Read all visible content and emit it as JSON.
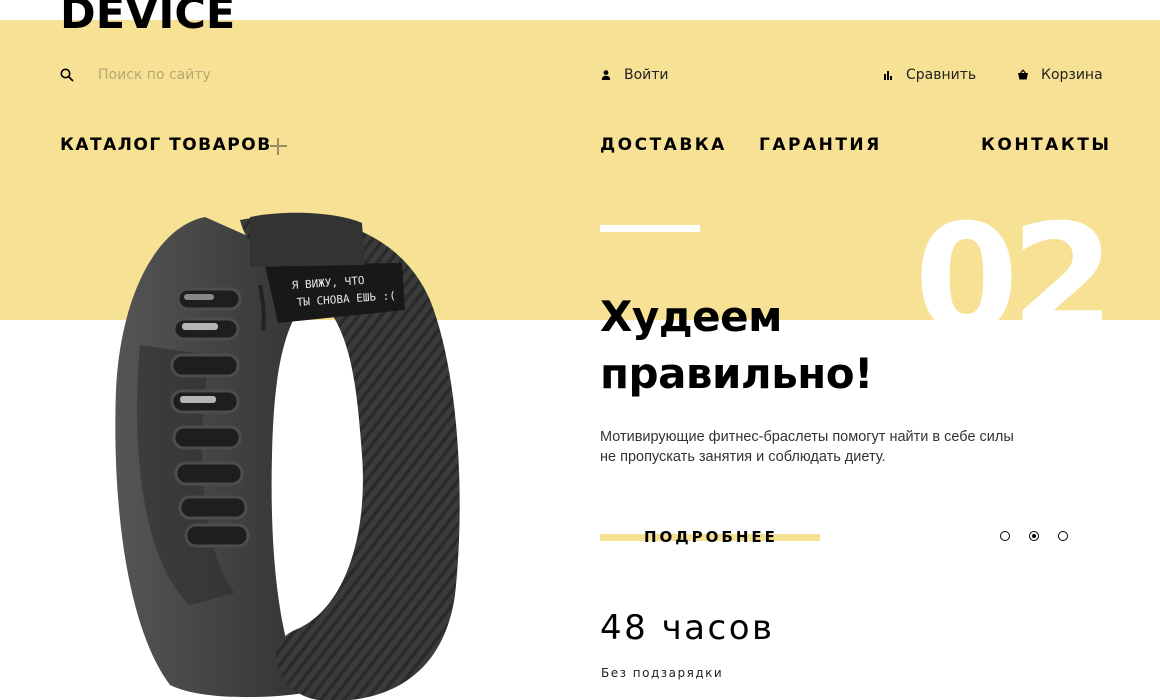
{
  "brand": {
    "logo": "DEVICE"
  },
  "search": {
    "placeholder": "Поиск по сайту"
  },
  "user_links": {
    "login": "Войти",
    "compare": "Сравнить",
    "cart": "Корзина"
  },
  "nav": {
    "catalog": "КАТАЛОГ ТОВАРОВ",
    "delivery": "ДОСТАВКА",
    "warranty": "ГАРАНТИЯ",
    "contacts": "КОНТАКТЫ"
  },
  "slide": {
    "number": "02",
    "title_line1": "Худеем",
    "title_line2": "правильно!",
    "description_line1": "Мотивирующие фитнес-браслеты помогут найти в себе силы",
    "description_line2": "не пропускать занятия и соблюдать диету.",
    "button": "ПОДРОБНЕЕ",
    "stat_value": "48 часов",
    "stat_label": "Без подзарядки",
    "display_line1": "Я ВИЖУ, ЧТО",
    "display_line2": "ТЫ СНОВА ЕШЬ :(",
    "current_index": 2,
    "total": 3
  },
  "colors": {
    "accent": "#f7e194",
    "text": "#000000",
    "product": "#3c3c3c"
  }
}
